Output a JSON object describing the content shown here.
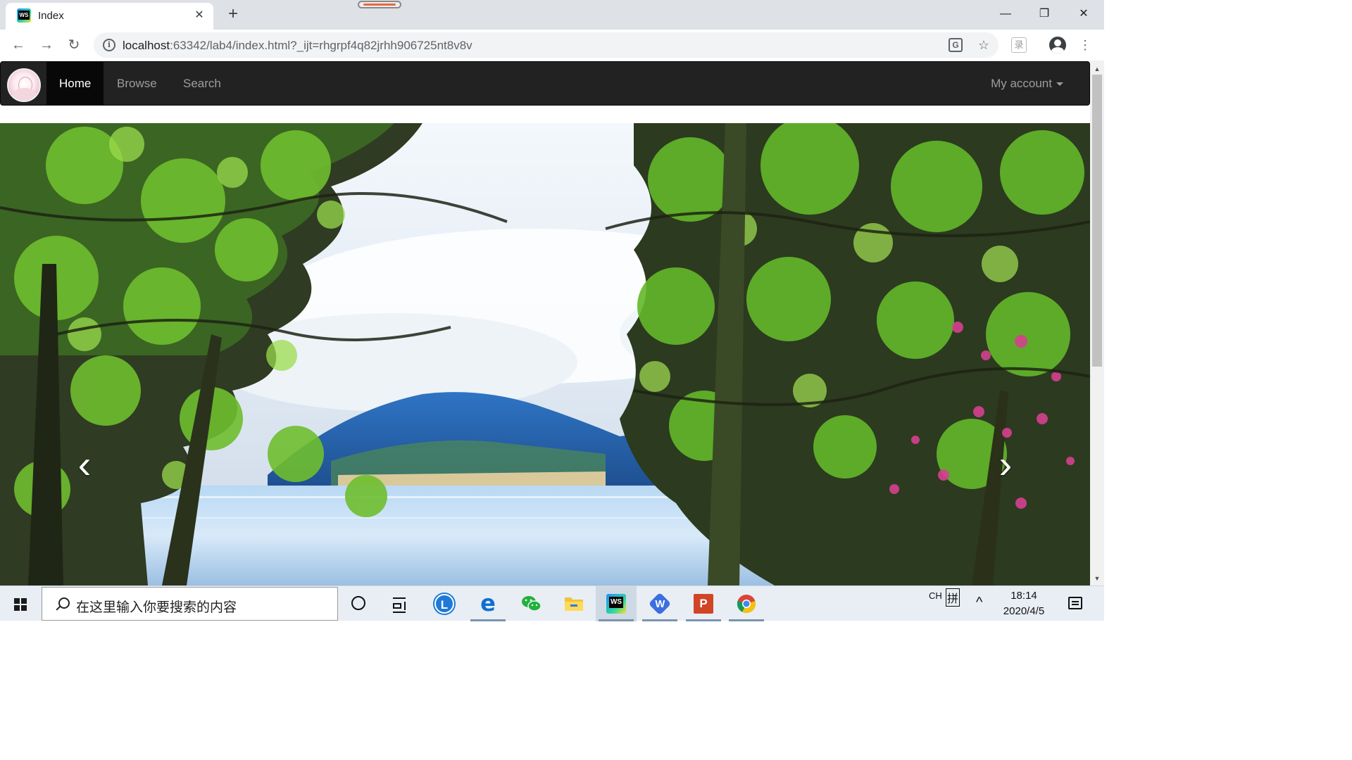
{
  "browser": {
    "tab_title": "Index",
    "tab_close": "✕",
    "new_tab": "+",
    "url_host": "localhost",
    "url_rest": ":63342/lab4/index.html?_ijt=rhgrpf4q82jrhh906725nt8v8v",
    "info": "i",
    "translate": "G",
    "ext": "录",
    "back": "←",
    "forward": "→",
    "reload": "↻",
    "star": "☆",
    "menu": "⋮",
    "minimize": "—",
    "restore": "❐",
    "close": "✕"
  },
  "navbar": {
    "items": [
      {
        "label": "Home",
        "active": true
      },
      {
        "label": "Browse",
        "active": false
      },
      {
        "label": "Search",
        "active": false
      }
    ],
    "account_label": "My account"
  },
  "carousel": {
    "prev": "‹",
    "next": "›"
  },
  "scrollbar": {
    "up": "▲",
    "down": "▼"
  },
  "taskbar": {
    "search_placeholder": "在这里输入你要搜索的内容",
    "lang": "CH",
    "ime": "拼",
    "tray_chevron": "^",
    "time": "18:14",
    "date": "2020/4/5",
    "apps": [
      {
        "name": "lync-app",
        "label": "L"
      },
      {
        "name": "edge-app",
        "label": "e"
      },
      {
        "name": "wechat-app",
        "label": ""
      },
      {
        "name": "file-explorer-app",
        "label": ""
      },
      {
        "name": "webstorm-app",
        "label": "WS"
      },
      {
        "name": "wps-app",
        "label": "W"
      },
      {
        "name": "powerpoint-app",
        "label": "P"
      },
      {
        "name": "chrome-app",
        "label": ""
      }
    ]
  }
}
